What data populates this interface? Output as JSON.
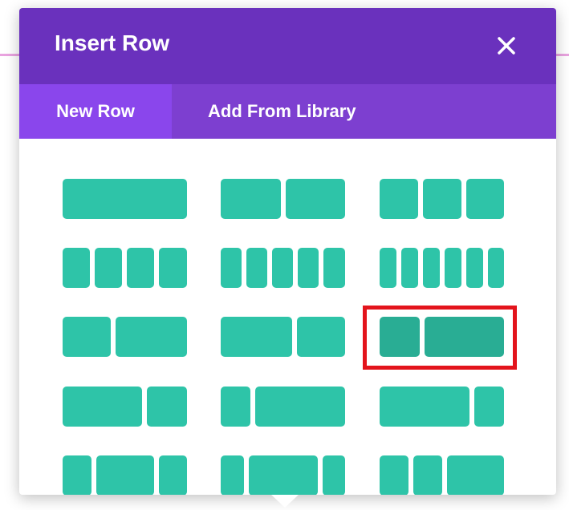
{
  "modal": {
    "title": "Insert Row",
    "close_icon": "close-icon",
    "tabs": [
      {
        "label": "New Row",
        "active": true
      },
      {
        "label": "Add From Library",
        "active": false
      }
    ],
    "selected_layout": "1/3 + 2/3"
  },
  "colors": {
    "header": "#6a31bd",
    "tab_bar": "#7d3fd0",
    "active_tab": "#8a46ec",
    "layout_block": "#2ec4a8",
    "selected_block": "#29ad94",
    "highlight": "#e3141c"
  },
  "layouts": [
    {
      "name": "layout-1-col",
      "cols": [
        1
      ]
    },
    {
      "name": "layout-1-2-1-2",
      "cols": [
        1,
        1
      ]
    },
    {
      "name": "layout-1-3x3",
      "cols": [
        1,
        1,
        1
      ]
    },
    {
      "name": "layout-1-4x4",
      "cols": [
        1,
        1,
        1,
        1
      ]
    },
    {
      "name": "layout-1-5x5",
      "cols": [
        1,
        1,
        1,
        1,
        1
      ]
    },
    {
      "name": "layout-1-6x6",
      "cols": [
        1,
        1,
        1,
        1,
        1,
        1
      ]
    },
    {
      "name": "layout-2-5-3-5",
      "cols": [
        2,
        3
      ]
    },
    {
      "name": "layout-3-5-2-5",
      "cols": [
        3,
        2
      ]
    },
    {
      "name": "layout-1-3-2-3",
      "cols": [
        1,
        2
      ],
      "selected": true
    },
    {
      "name": "layout-2-3-1-3",
      "cols": [
        2,
        1
      ]
    },
    {
      "name": "layout-1-4-3-4",
      "cols": [
        1,
        3
      ]
    },
    {
      "name": "layout-3-4-1-4",
      "cols": [
        3,
        1
      ]
    },
    {
      "name": "layout-1-4-1-2-1-4",
      "cols": [
        1,
        2,
        1
      ]
    },
    {
      "name": "layout-1-5-3-5-1-5",
      "cols": [
        1,
        3,
        1
      ]
    },
    {
      "name": "layout-1-4-1-4-1-2",
      "cols": [
        1,
        1,
        2
      ]
    }
  ]
}
